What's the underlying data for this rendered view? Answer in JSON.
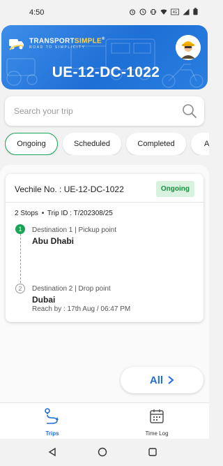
{
  "status_bar": {
    "time": "4:50",
    "icons": [
      "alarm-icon",
      "clock-icon",
      "vibrate-icon",
      "wifi-icon",
      "lte-icon",
      "signal-icon",
      "battery-icon"
    ]
  },
  "header": {
    "brand_part1": "TRANSPORT",
    "brand_part2": "SIMPLE",
    "brand_mark": "®",
    "tagline": "ROAD TO SIMPLICITY",
    "vehicle_number": "UE-12-DC-1022",
    "brand_color": "#1e6fd6"
  },
  "search": {
    "placeholder": "Search your trip"
  },
  "tabs": [
    {
      "label": "Ongoing",
      "active": true
    },
    {
      "label": "Scheduled",
      "active": false
    },
    {
      "label": "Completed",
      "active": false
    },
    {
      "label": "All",
      "active": false
    }
  ],
  "trip_card": {
    "vehicle_label": "Vechile No. : UE-12-DC-1022",
    "status": "Ongoing",
    "stops_count": "2 Stops",
    "trip_id": "Trip ID : T/202308/25",
    "stops": [
      {
        "number": "1",
        "label": "Destination 1  |  Pickup point",
        "city": "Abu Dhabi",
        "reach_by": ""
      },
      {
        "number": "2",
        "label": "Destination 2  |  Drop point",
        "city": "Dubai",
        "reach_by": "Reach by : 17th Aug / 06:47 PM"
      }
    ],
    "status_color": "#14903f"
  },
  "all_button": {
    "label": "All"
  },
  "bottom_nav": [
    {
      "label": "Trips",
      "active": true
    },
    {
      "label": "Time Log",
      "active": false
    }
  ]
}
